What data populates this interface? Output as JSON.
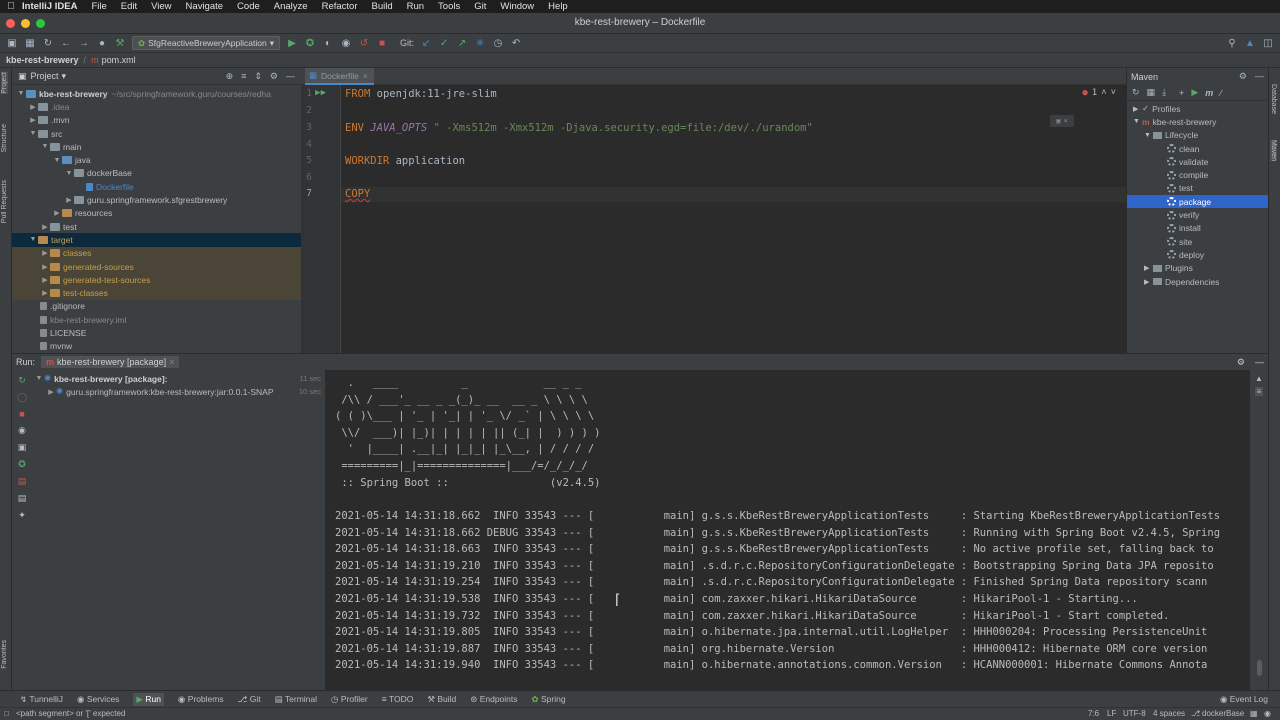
{
  "menubar": {
    "app": "IntelliJ IDEA",
    "items": [
      "File",
      "Edit",
      "View",
      "Navigate",
      "Code",
      "Analyze",
      "Refactor",
      "Build",
      "Run",
      "Tools",
      "Git",
      "Window",
      "Help"
    ]
  },
  "window": {
    "title": "kbe-rest-brewery – Dockerfile"
  },
  "toolbar": {
    "run_config": "SfgReactiveBreweryApplication",
    "git_label": "Git:"
  },
  "navbar": {
    "project": "kbe-rest-brewery",
    "file": "pom.xml"
  },
  "project_panel": {
    "title": "Project",
    "root_name": "kbe-rest-brewery",
    "root_path": "~/src/springframework.guru/courses/redha",
    "items": [
      ".idea",
      ".mvn",
      "src",
      "main",
      "java",
      "dockerBase",
      "Dockerfile",
      "guru.springframework.sfgrestbrewery",
      "resources",
      "test",
      "target",
      "classes",
      "generated-sources",
      "generated-test-sources",
      "test-classes",
      ".gitignore",
      "kbe-rest-brewery.iml",
      "LICENSE",
      "mvnw"
    ]
  },
  "editor": {
    "tab": "Dockerfile",
    "error_count": "1",
    "lines": {
      "l1_kw": "FROM",
      "l1_rest": " openjdk:11-jre-slim",
      "l3_kw": "ENV",
      "l3_var": " JAVA_OPTS",
      "l3_str": " \" -Xms512m -Xmx512m -Djava.security.egd=file:/dev/./urandom\"",
      "l5_kw": "WORKDIR",
      "l5_rest": " application",
      "l7_kw": "COPY"
    },
    "line_numbers": [
      "1",
      "2",
      "3",
      "4",
      "5",
      "6",
      "7"
    ]
  },
  "maven_panel": {
    "title": "Maven",
    "profiles": "Profiles",
    "project": "kbe-rest-brewery",
    "lifecycle": "Lifecycle",
    "goals": [
      "clean",
      "validate",
      "compile",
      "test",
      "package",
      "verify",
      "install",
      "site",
      "deploy"
    ],
    "selected_goal": "package",
    "plugins": "Plugins",
    "dependencies": "Dependencies"
  },
  "side_labels": {
    "left": [
      "Project",
      "Structure",
      "Pull Requests",
      "Favorites"
    ],
    "right": [
      "Database",
      "Maven"
    ]
  },
  "run_panel": {
    "label": "Run:",
    "tab": "kbe-rest-brewery [package]",
    "tree_root": "kbe-rest-brewery [package]:",
    "tree_root_time": "11 sec",
    "tree_child": "guru.springframework:kbe-rest-brewery:jar:0.0.1-SNAP",
    "tree_child_time": "10 sec",
    "banner": [
      "  .   ____          _            __ _ _",
      " /\\\\ / ___'_ __ _ _(_)_ __  __ _ \\ \\ \\ \\",
      "( ( )\\___ | '_ | '_| | '_ \\/ _` | \\ \\ \\ \\",
      " \\\\/  ___)| |_)| | | | | || (_| |  ) ) ) )",
      "  '  |____| .__|_| |_|_| |_\\__, | / / / /",
      " =========|_|==============|___/=/_/_/_/",
      " :: Spring Boot ::                (v2.4.5)"
    ],
    "log": [
      "2021-05-14 14:31:18.662  INFO 33543 --- [           main] g.s.s.KbeRestBreweryApplicationTests     : Starting KbeRestBreweryApplicationTests",
      "2021-05-14 14:31:18.662 DEBUG 33543 --- [           main] g.s.s.KbeRestBreweryApplicationTests     : Running with Spring Boot v2.4.5, Spring",
      "2021-05-14 14:31:18.663  INFO 33543 --- [           main] g.s.s.KbeRestBreweryApplicationTests     : No active profile set, falling back to",
      "2021-05-14 14:31:19.210  INFO 33543 --- [           main] .s.d.r.c.RepositoryConfigurationDelegate : Bootstrapping Spring Data JPA reposito",
      "2021-05-14 14:31:19.254  INFO 33543 --- [           main] .s.d.r.c.RepositoryConfigurationDelegate : Finished Spring Data repository scann",
      "2021-05-14 14:31:19.538  INFO 33543 --- [           main] com.zaxxer.hikari.HikariDataSource       : HikariPool-1 - Starting...",
      "2021-05-14 14:31:19.732  INFO 33543 --- [           main] com.zaxxer.hikari.HikariDataSource       : HikariPool-1 - Start completed.",
      "2021-05-14 14:31:19.805  INFO 33543 --- [           main] o.hibernate.jpa.internal.util.LogHelper  : HHH000204: Processing PersistenceUnit",
      "2021-05-14 14:31:19.887  INFO 33543 --- [           main] org.hibernate.Version                    : HHH000412: Hibernate ORM core version",
      "2021-05-14 14:31:19.940  INFO 33543 --- [           main] o.hibernate.annotations.common.Version   : HCANN000001: Hibernate Commons Annota"
    ]
  },
  "bottom_tools": [
    "TunnelliJ",
    "Services",
    "Run",
    "Problems",
    "Git",
    "Terminal",
    "Profiler",
    "TODO",
    "Build",
    "Endpoints",
    "Spring"
  ],
  "event_log": "Event Log",
  "status": {
    "message": "<path segment> or '[' expected",
    "position": "7:6",
    "line_sep": "LF",
    "encoding": "UTF-8",
    "indent": "4 spaces",
    "branch": "dockerBase"
  },
  "colors": {
    "accent": "#2f65ca",
    "keyword": "#cc7832",
    "string": "#6a8759",
    "variable": "#9876aa"
  }
}
